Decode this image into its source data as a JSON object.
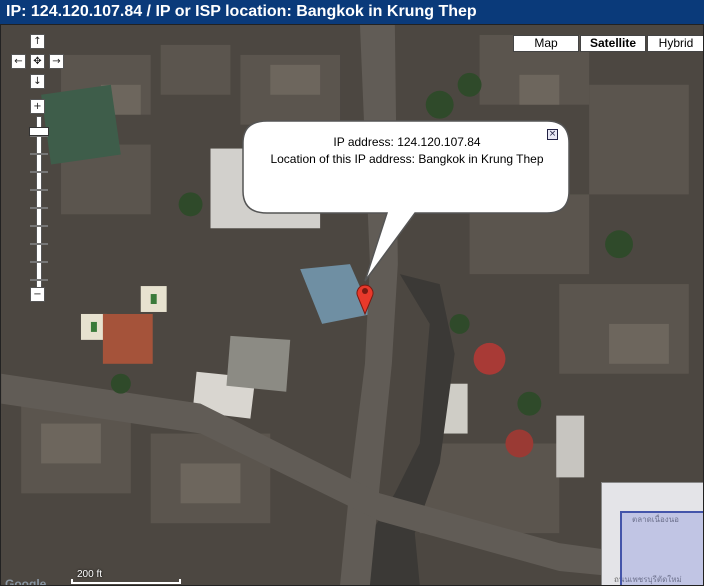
{
  "header": {
    "title": "IP: 124.120.107.84 / IP or ISP location: Bangkok in Krung Thep"
  },
  "map": {
    "type_buttons": [
      {
        "label": "Map",
        "active": false
      },
      {
        "label": "Satellite",
        "active": true
      },
      {
        "label": "Hybrid",
        "active": false
      }
    ],
    "nav_icons": {
      "up": "↑",
      "down": "↓",
      "left": "←",
      "right": "→",
      "center": "✥",
      "zoom_in": "+",
      "zoom_out": "−"
    },
    "info_window": {
      "line1": "IP address: 124.120.107.84",
      "line2": "Location of this IP address: Bangkok in Krung Thep",
      "close_glyph": "×"
    },
    "scale": {
      "label": "200 ft"
    },
    "logo": "Google",
    "overview": {
      "label_top": "ตลาดเนื่องนอ",
      "label_bottom": "ถนนเพชรบุรีตัดใหม่"
    },
    "colors": {
      "title_bar": "#0a3a7a",
      "marker": "#e8392b",
      "overview_viewport": "#4455aa"
    }
  }
}
